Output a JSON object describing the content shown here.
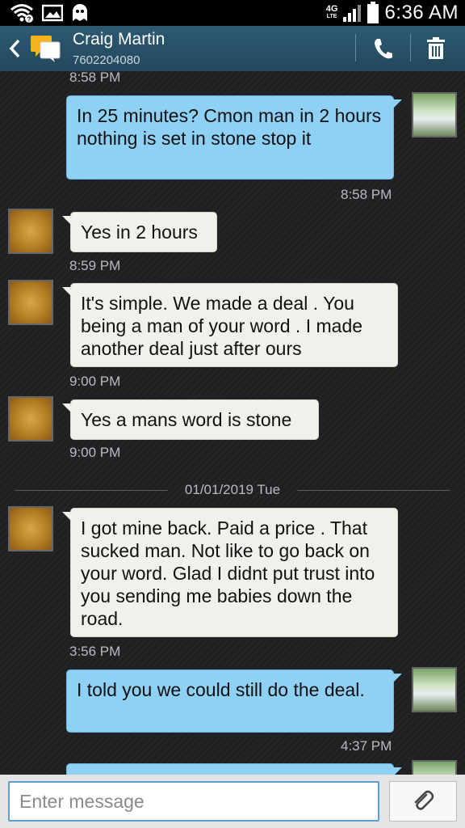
{
  "status_bar": {
    "time": "6:36 AM",
    "network": "4G",
    "network_sub": "LTE"
  },
  "header": {
    "contact_name": "Craig Martin",
    "contact_number": "7602204080"
  },
  "messages": [
    {
      "dir": "out",
      "text": "In 25 minutes? Cmon man in 2 hours nothing is set in stone stop it",
      "time": "8:58 PM"
    },
    {
      "dir": "in",
      "text": "Yes in 2 hours",
      "time": "8:59 PM"
    },
    {
      "dir": "in",
      "text": "It's simple.  We made a deal . You being a man of your word . I made another deal just after ours",
      "time": "9:00 PM"
    },
    {
      "dir": "in",
      "text": "Yes a mans word is stone",
      "time": "9:00 PM"
    },
    {
      "dir": "in",
      "text": "I got mine back. Paid a price . That sucked  man. Not like to go back on your word. Glad I didnt put trust into you sending me babies down the road.",
      "time": "3:56 PM"
    },
    {
      "dir": "out",
      "text": "I told you we could still do the deal.",
      "time": "4:37 PM"
    }
  ],
  "previous_time": "8:58 PM",
  "date_divider": "01/01/2019 Tue",
  "composer": {
    "placeholder": "Enter message"
  },
  "colors": {
    "outgoing_bubble": "#8fd0f5",
    "incoming_bubble": "#f1f0ea",
    "header": "#2d5a72"
  }
}
